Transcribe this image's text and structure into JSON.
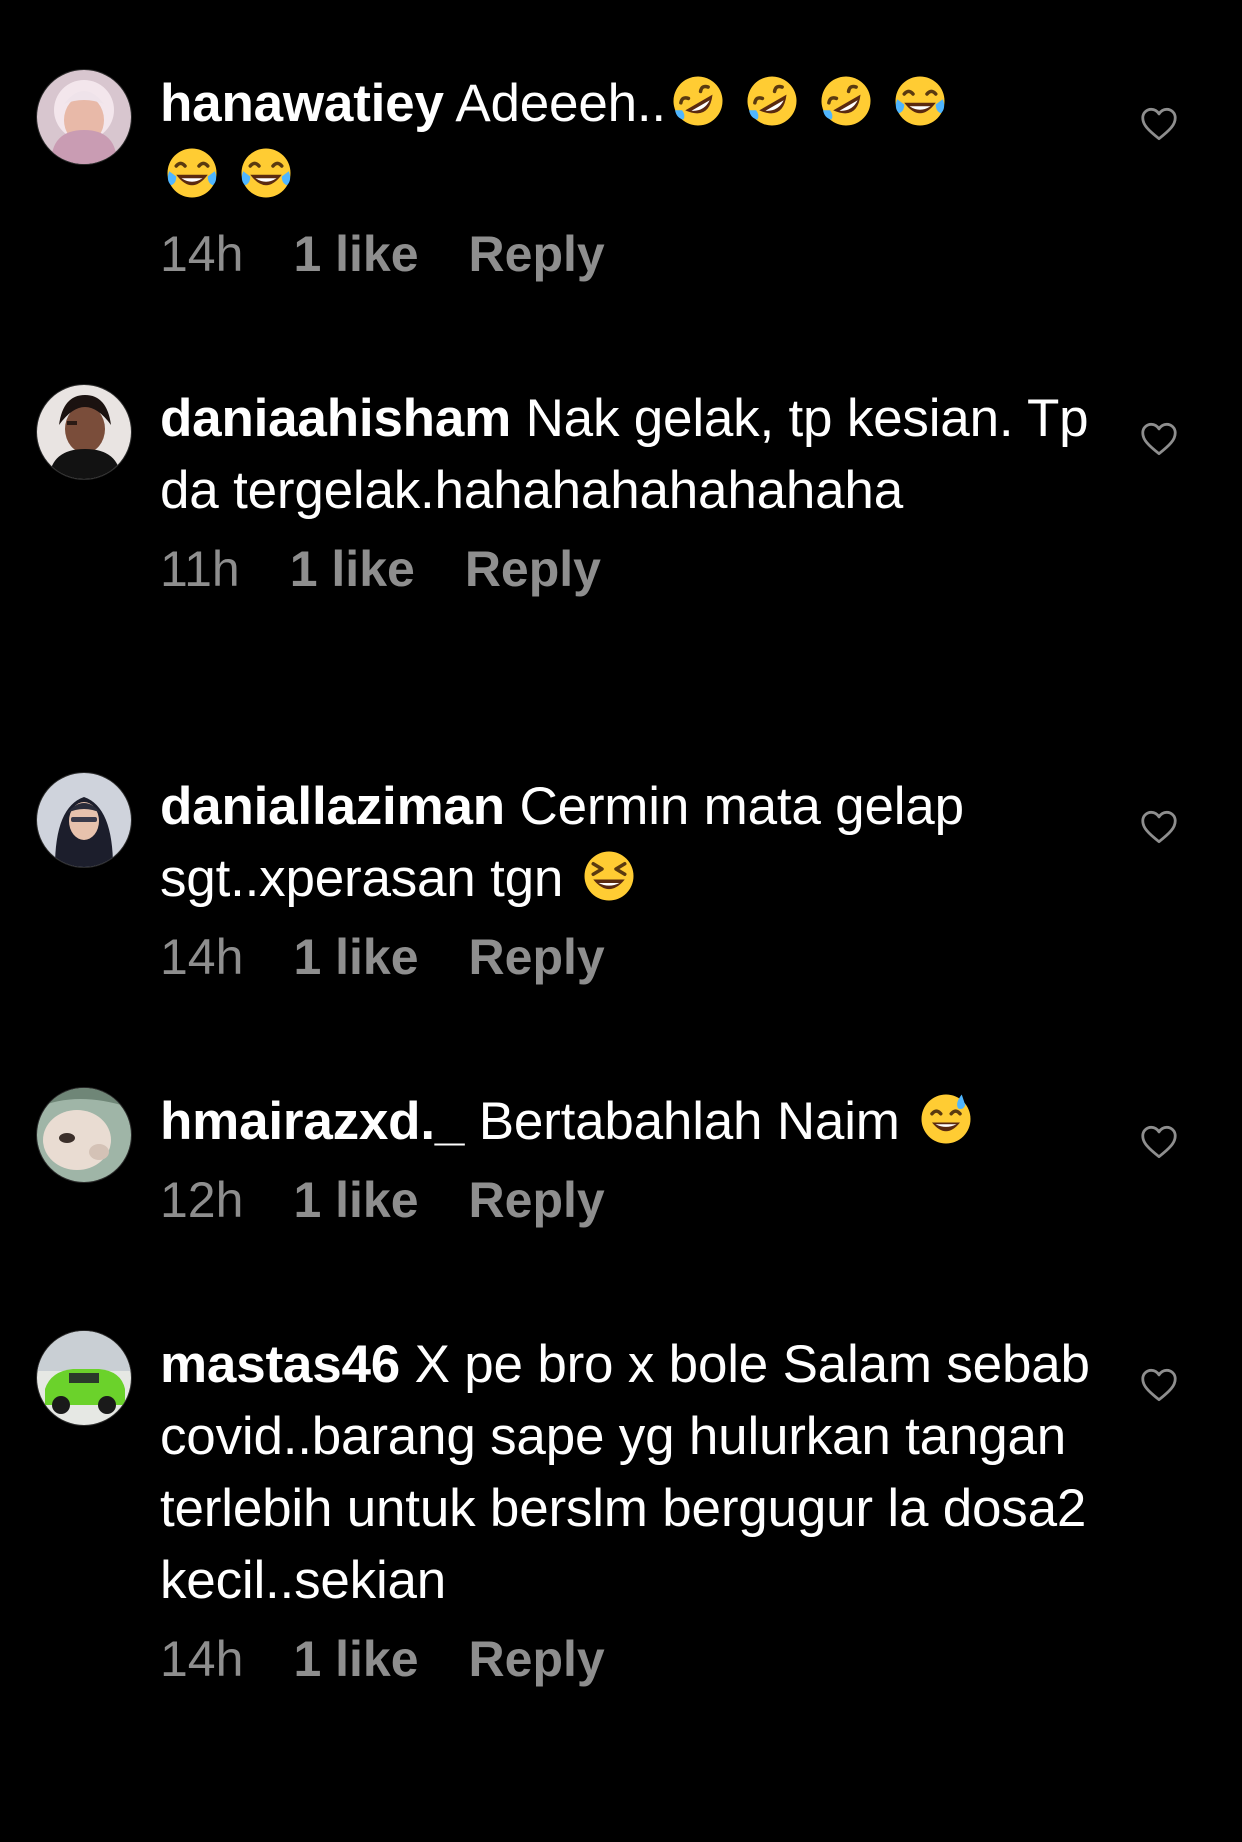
{
  "comments": [
    {
      "username": "hanawatiey",
      "text": "Adeeeh..",
      "emojis": [
        "rolling-laughing-emoji",
        "rolling-laughing-emoji",
        "rolling-laughing-emoji",
        "tears-of-joy-emoji",
        "tears-of-joy-emoji",
        "tears-of-joy-emoji"
      ],
      "time": "14h",
      "likes": "1 like",
      "reply": "Reply"
    },
    {
      "username": "daniaahisham",
      "text": "Nak gelak, tp kesian. Tp da tergelak.hahahahahahahaha",
      "time": "11h",
      "likes": "1 like",
      "reply": "Reply"
    },
    {
      "username": "daniallaziman",
      "text": "Cermin mata gelap sgt..xperasan tgn",
      "emojis": [
        "grinning-squinting-emoji"
      ],
      "time": "14h",
      "likes": "1 like",
      "reply": "Reply"
    },
    {
      "username": "hmairazxd._",
      "text": "Bertabahlah Naim",
      "emojis": [
        "grinning-sweat-emoji"
      ],
      "time": "12h",
      "likes": "1 like",
      "reply": "Reply"
    },
    {
      "username": "mastas46",
      "text": "X pe bro x bole Salam sebab covid..barang sape yg hulurkan tangan terlebih untuk berslm bergugur la dosa2 kecil..sekian",
      "time": "14h",
      "likes": "1 like",
      "reply": "Reply"
    }
  ],
  "colors": {
    "background": "#000000",
    "text": "#ffffff",
    "meta": "#8e8e8e",
    "heart": "#8e8e8e"
  }
}
